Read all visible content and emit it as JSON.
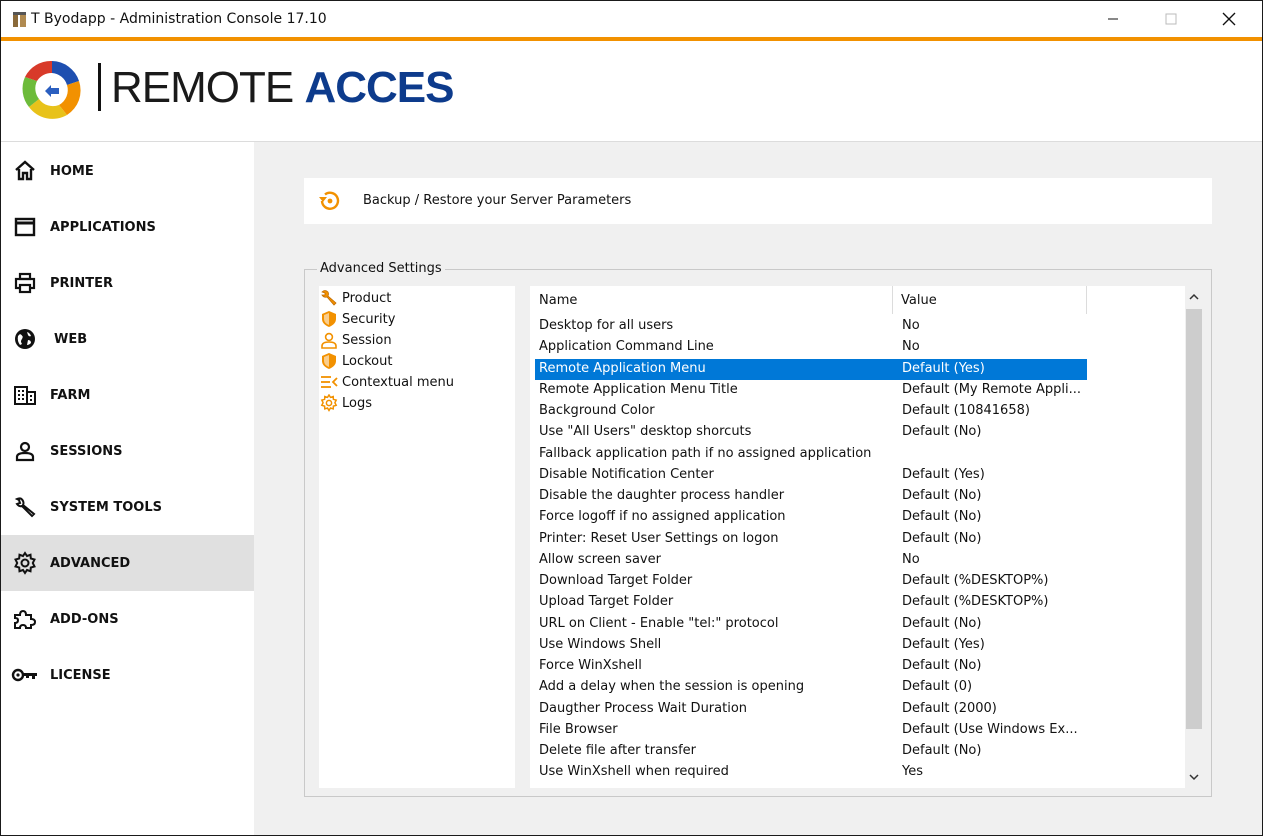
{
  "window": {
    "title": "T  Byodapp - Administration Console 17.10",
    "controls": {
      "minimize": "minimize-icon",
      "maximize": "maximize-icon",
      "close": "close-icon"
    }
  },
  "brand": {
    "text_dark": "REMOTE ",
    "text_blue": "ACCES",
    "accent_color": "#f29100",
    "blue_color": "#0d3b8c"
  },
  "sidebar": {
    "items": [
      {
        "label": "HOME",
        "icon": "home-icon"
      },
      {
        "label": "APPLICATIONS",
        "icon": "window-icon"
      },
      {
        "label": "PRINTER",
        "icon": "printer-icon"
      },
      {
        "label": "WEB",
        "icon": "globe-icon"
      },
      {
        "label": "FARM",
        "icon": "building-icon"
      },
      {
        "label": "SESSIONS",
        "icon": "user-icon"
      },
      {
        "label": "SYSTEM TOOLS",
        "icon": "wrench-icon"
      },
      {
        "label": "ADVANCED",
        "icon": "gear-icon",
        "active": true
      },
      {
        "label": "ADD-ONS",
        "icon": "puzzle-icon"
      },
      {
        "label": "LICENSE",
        "icon": "key-icon"
      }
    ]
  },
  "backup": {
    "label": "Backup / Restore your Server Parameters",
    "icon": "restore-icon"
  },
  "advanced": {
    "group_title": "Advanced Settings",
    "tree": [
      {
        "label": "Product",
        "icon": "wrench-icon"
      },
      {
        "label": "Security",
        "icon": "shield-icon"
      },
      {
        "label": "Session",
        "icon": "user-icon"
      },
      {
        "label": "Lockout",
        "icon": "shield-icon"
      },
      {
        "label": "Contextual menu",
        "icon": "menu-icon"
      },
      {
        "label": "Logs",
        "icon": "gear-icon"
      }
    ],
    "columns": {
      "name": "Name",
      "value": "Value"
    },
    "selected_row": 2,
    "rows": [
      {
        "name": "Desktop for all users",
        "value": "No"
      },
      {
        "name": "Application Command Line",
        "value": "No"
      },
      {
        "name": "Remote Application Menu",
        "value": "Default (Yes)"
      },
      {
        "name": "Remote Application Menu Title",
        "value": "Default (My Remote Appli..."
      },
      {
        "name": "Background Color",
        "value": "Default (10841658)"
      },
      {
        "name": "Use \"All Users\" desktop shorcuts",
        "value": "Default (No)"
      },
      {
        "name": "Fallback application path if no assigned application",
        "value": ""
      },
      {
        "name": "Disable Notification Center",
        "value": "Default (Yes)"
      },
      {
        "name": "Disable the daughter process handler",
        "value": "Default (No)"
      },
      {
        "name": "Force logoff if no assigned application",
        "value": "Default (No)"
      },
      {
        "name": "Printer: Reset User Settings on logon",
        "value": "Default (No)"
      },
      {
        "name": "Allow screen saver",
        "value": "No"
      },
      {
        "name": "Download Target Folder",
        "value": "Default (%DESKTOP%)"
      },
      {
        "name": "Upload Target Folder",
        "value": "Default (%DESKTOP%)"
      },
      {
        "name": "URL on Client - Enable \"tel:\" protocol",
        "value": "Default (No)"
      },
      {
        "name": "Use Windows Shell",
        "value": "Default (Yes)"
      },
      {
        "name": "Force WinXshell",
        "value": "Default (No)"
      },
      {
        "name": "Add a delay when the session is opening",
        "value": "Default (0)"
      },
      {
        "name": "Daugther Process Wait Duration",
        "value": "Default (2000)"
      },
      {
        "name": "File Browser",
        "value": "Default (Use Windows Ex..."
      },
      {
        "name": "Delete file after transfer",
        "value": "Default (No)"
      },
      {
        "name": "Use WinXshell when required",
        "value": "Yes"
      }
    ]
  }
}
